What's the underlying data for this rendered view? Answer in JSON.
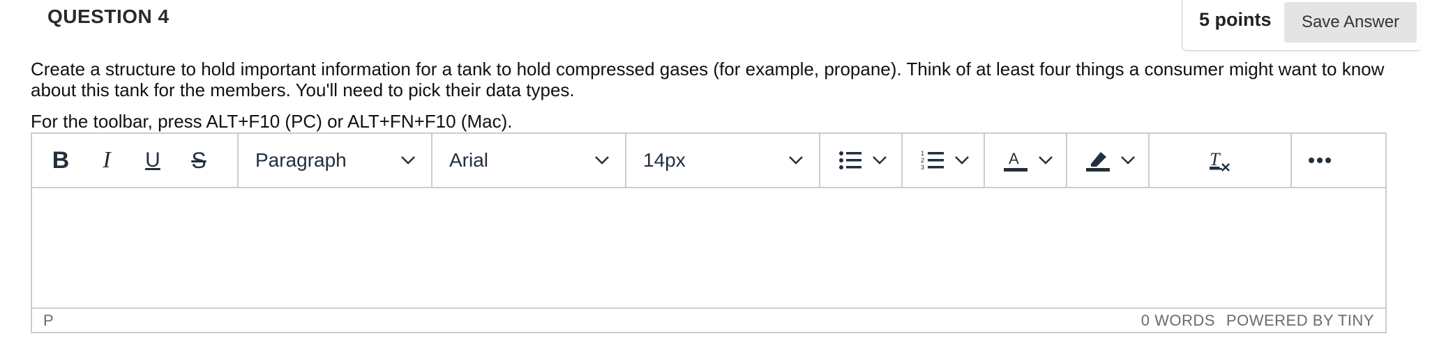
{
  "question": {
    "header": "QUESTION 4",
    "points": "5 points",
    "save_label": "Save Answer",
    "text": "Create a structure to hold important information for a tank to hold compressed gases (for example, propane). Think of at least four things a consumer might want to know about this tank for the members. You'll need to pick their data types.",
    "toolbar_hint": "For the toolbar, press ALT+F10 (PC) or ALT+FN+F10 (Mac)."
  },
  "editor": {
    "toolbar": {
      "bold_glyph": "B",
      "italic_glyph": "I",
      "underline_glyph": "U",
      "strike_glyph": "S",
      "block_format": "Paragraph",
      "font_family": "Arial",
      "font_size": "14px",
      "icons": [
        "bold-icon",
        "italic-icon",
        "underline-icon",
        "strikethrough-icon",
        "bullet-list-icon",
        "numbered-list-icon",
        "text-color-icon",
        "highlight-icon",
        "clear-formatting-icon",
        "more-icon"
      ]
    },
    "content": "",
    "status": {
      "path": "P",
      "words": "0 WORDS",
      "powered": "POWERED BY TINY"
    }
  },
  "colors": {
    "toolbar_icon": "#222f3e",
    "border": "#cccccc",
    "save_button_bg": "#e4e4e4",
    "status_text": "#6b6b6b"
  }
}
